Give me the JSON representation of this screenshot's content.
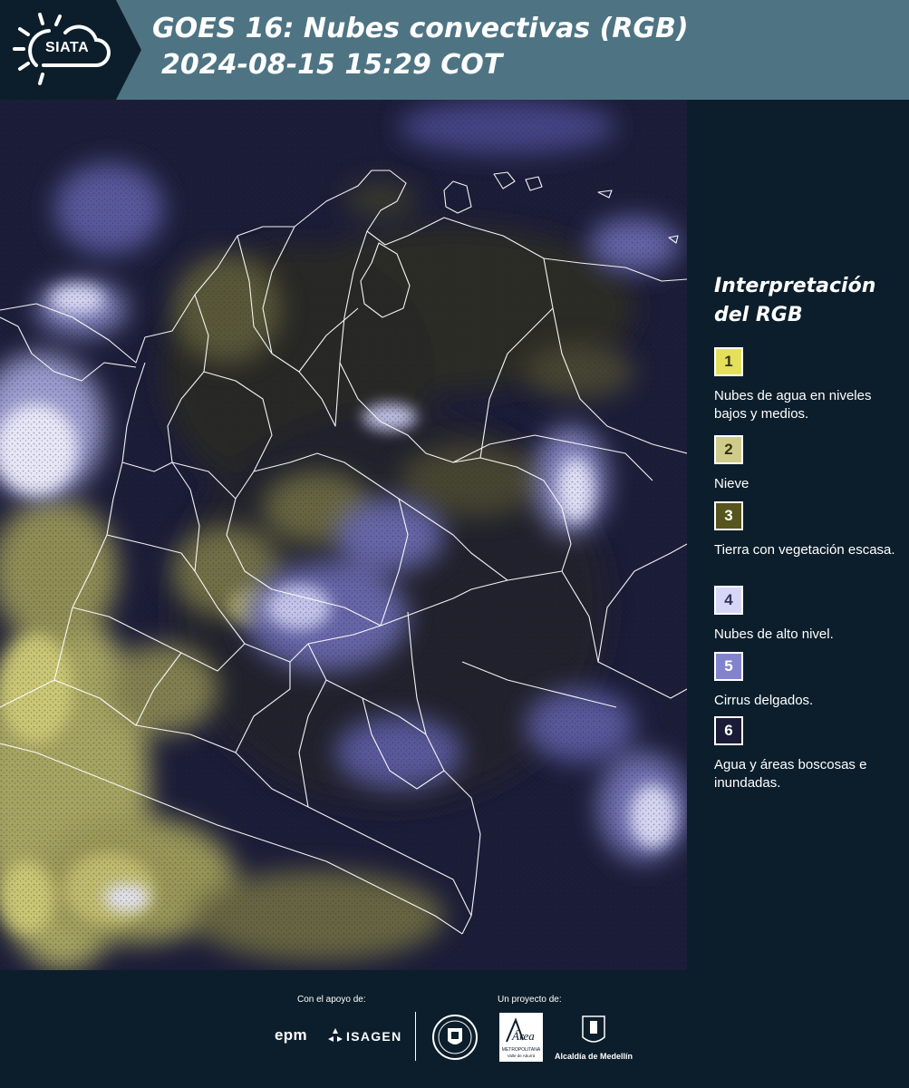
{
  "header": {
    "logo_text": "SIATA",
    "title_line1": "GOES 16: Nubes convectivas (RGB)",
    "title_line2": "2024-08-15 15:29 COT",
    "logo_icon": "sun-cloud-icon"
  },
  "legend": {
    "title_line1": "Interpretación",
    "title_line2": "del RGB",
    "items": [
      {
        "number": "1",
        "label": "Nubes de agua en niveles bajos y medios.",
        "color": "#e4e05c"
      },
      {
        "number": "2",
        "label": "Nieve",
        "color": "#cfcb8a"
      },
      {
        "number": "3",
        "label": "Tierra con vegetación escasa.",
        "color": "#55551d"
      },
      {
        "number": "4",
        "label": "Nubes de alto nivel.",
        "color": "#d6d6f6"
      },
      {
        "number": "5",
        "label": "Cirrus delgados.",
        "color": "#8383cd"
      },
      {
        "number": "6",
        "label": "Agua y áreas boscosas e inundadas.",
        "color": "#1a1b36"
      }
    ]
  },
  "footer": {
    "support_label": "Con el apoyo de:",
    "project_label": "Un proyecto de:",
    "epm": "epm",
    "isagen": "ISAGEN",
    "area_logo_text": "Área",
    "area_sub": "METROPOLITANA",
    "area_sub2": "Valle de Aburrá",
    "alcaldia": "Alcaldía de Medellín"
  },
  "colors": {
    "header_bg": "#4e7483",
    "panel_bg": "#0c1e2b",
    "map_base": "#1b1c38",
    "low_cloud": "#d8d46a",
    "high_cloud": "#c9c9f2"
  }
}
